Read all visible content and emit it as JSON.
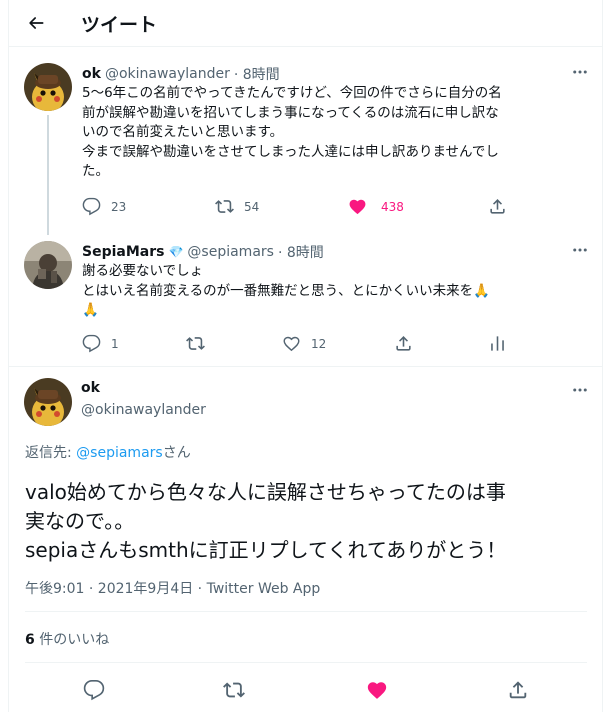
{
  "header": {
    "title": "ツイート",
    "back_icon": "arrow-left-icon"
  },
  "tweets": [
    {
      "name": "ok",
      "handle": "@okinawaylander",
      "time": "· 8時間",
      "text": "5〜6年この名前でやってきたんですけど、今回の件でさらに自分の名\n前が誤解や勘違いを招いてしまう事になってくるのは流石に申し訳な\nいので名前変えたいと思います。\n今まで誤解や勘違いをさせてしまった人達には申し訳ありませんでし\nた。",
      "replies": "23",
      "retweets": "54",
      "likes": "438",
      "liked": true
    },
    {
      "name": "SepiaMars",
      "badge": "💎",
      "handle": "@sepiamars",
      "time": "· 8時間",
      "text": "謝る必要ないでしょ\nとはいえ名前変えるのが一番無難だと思う、とにかくいい未来を🙏\n🙏",
      "replies": "1",
      "retweets": "",
      "likes": "12",
      "liked": false
    }
  ],
  "main_tweet": {
    "name": "ok",
    "handle": "@okinawaylander",
    "reply_to_prefix": "返信先: ",
    "reply_to_handle": "@sepiamars",
    "reply_to_suffix": "さん",
    "text": "valo始めてから色々な人に誤解させちゃってたのは事\n実なので。。\nsepiaさんもsmthに訂正リプしてくれてありがとう！",
    "meta": "午後9:01 · 2021年9月4日 · Twitter Web App",
    "likes_count": "6",
    "likes_label": " 件のいいね"
  },
  "colors": {
    "accent": "#1d9bf0",
    "like": "#f91880",
    "muted": "#536471"
  }
}
